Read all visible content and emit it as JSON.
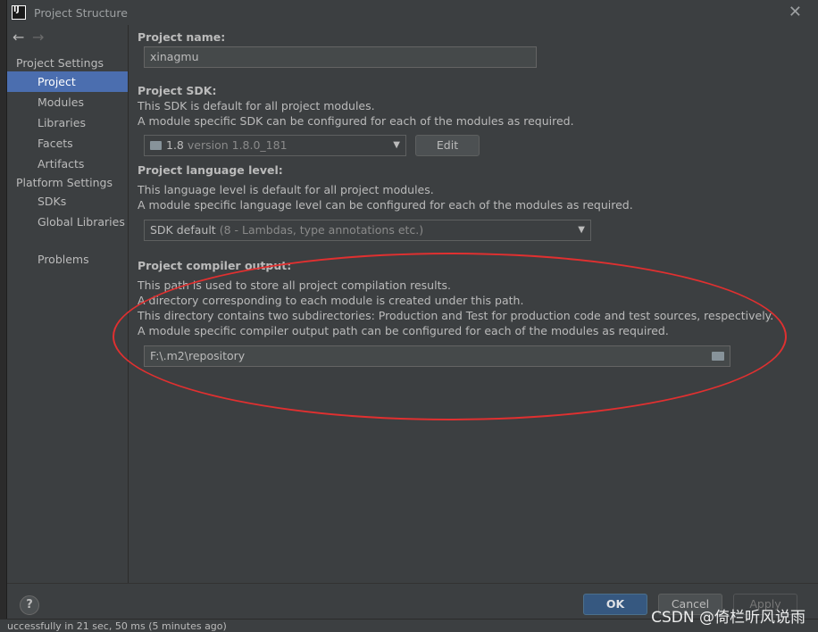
{
  "window": {
    "title": "Project Structure",
    "close_glyph": "✕"
  },
  "nav": {
    "back": "←",
    "forward": "→"
  },
  "sidebar": {
    "group_project_settings": "Project Settings",
    "project_items": [
      {
        "label": "Project",
        "selected": true
      },
      {
        "label": "Modules"
      },
      {
        "label": "Libraries"
      },
      {
        "label": "Facets"
      },
      {
        "label": "Artifacts"
      }
    ],
    "group_platform_settings": "Platform Settings",
    "platform_items": [
      {
        "label": "SDKs"
      },
      {
        "label": "Global Libraries"
      }
    ],
    "problems": "Problems"
  },
  "project": {
    "name_label": "Project name:",
    "name_value": "xinagmu",
    "sdk_label": "Project SDK:",
    "sdk_desc_1": "This SDK is default for all project modules.",
    "sdk_desc_2": "A module specific SDK can be configured for each of the modules as required.",
    "sdk_selected_main": "1.8",
    "sdk_selected_detail": "version 1.8.0_181",
    "edit_button": "Edit",
    "language_label": "Project language level:",
    "language_desc_1": "This language level is default for all project modules.",
    "language_desc_2": "A module specific language level can be configured for each of the modules as required.",
    "language_selected_main": "SDK default",
    "language_selected_detail": "(8 - Lambdas, type annotations etc.)",
    "compiler_label": "Project compiler output:",
    "compiler_desc_1": "This path is used to store all project compilation results.",
    "compiler_desc_2": "A directory corresponding to each module is created under this path.",
    "compiler_desc_3": "This directory contains two subdirectories: Production and Test for production code and test sources, respectively.",
    "compiler_desc_4": "A module specific compiler output path can be configured for each of the modules as required.",
    "compiler_path": "F:\\.m2\\repository"
  },
  "footer": {
    "help": "?",
    "ok": "OK",
    "cancel": "Cancel",
    "apply": "Apply"
  },
  "background": {
    "status_text": "uccessfully in 21 sec, 50 ms (5 minutes ago)"
  },
  "watermark": "CSDN @倚栏听风说雨",
  "colors": {
    "dialog_bg": "#3c3f41",
    "selection": "#4b6eaf",
    "ok_button": "#365880",
    "annotation_ellipse": "#e03030"
  }
}
